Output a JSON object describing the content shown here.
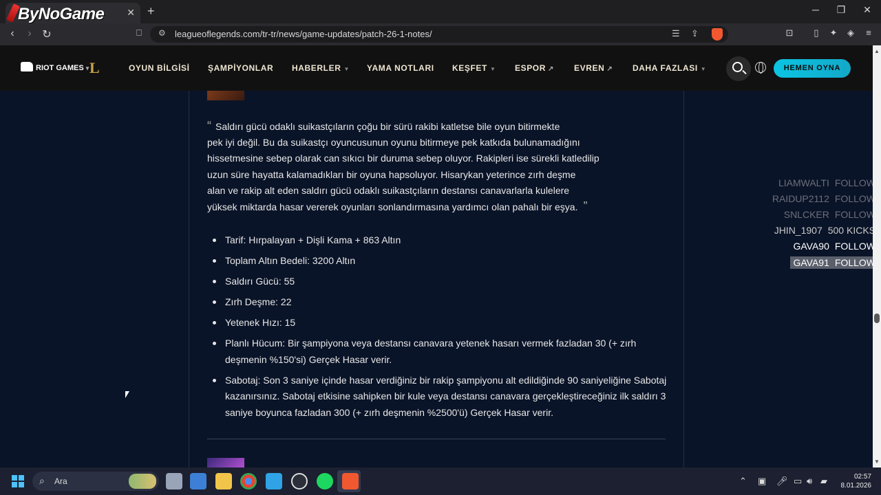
{
  "browser": {
    "tab_title": "ByNoGame",
    "url": "leagueoflegends.com/tr-tr/news/game-updates/patch-26-1-notes/"
  },
  "header": {
    "riot_logo": "RIOT GAMES",
    "nav": [
      {
        "label": "OYUN BİLGİSİ",
        "caret": false,
        "ext": false
      },
      {
        "label": "ŞAMPİYONLAR",
        "caret": false,
        "ext": false
      },
      {
        "label": "HABERLER",
        "caret": true,
        "ext": false
      },
      {
        "label": "YAMA NOTLARI",
        "caret": false,
        "ext": false
      },
      {
        "label": "KEŞFET",
        "caret": true,
        "ext": false
      },
      {
        "label": "ESPOR",
        "caret": false,
        "ext": true
      },
      {
        "label": "EVREN",
        "caret": false,
        "ext": true
      },
      {
        "label": "DAHA FAZLASI",
        "caret": true,
        "ext": false
      }
    ],
    "play_button": "HEMEN OYNA"
  },
  "article": {
    "quote": "Saldırı gücü odaklı suikastçıların çoğu bir sürü rakibi katletse bile oyun bitirmekte pek iyi değil. Bu da suikastçı oyuncusunun oyunu bitirmeye pek katkıda bulunamadığını hissetmesine sebep olarak can sıkıcı bir duruma sebep oluyor. Rakipleri ise sürekli katledilip uzun süre hayatta kalamadıkları bir oyuna hapsoluyor. Hisarykan yeterince zırh deşme alan ve rakip alt eden saldırı gücü odaklı suikastçıların destansı canavarlarla kulelere yüksek miktarda hasar vererek oyunları sonlandırmasına yardımcı olan pahalı bir eşya.",
    "quote_lines": [
      "Saldırı gücü odaklı suikastçıların çoğu bir sürü rakibi katletse bile oyun bitirmekte",
      "pek iyi değil. Bu da suikastçı oyuncusunun oyunu bitirmeye pek katkıda bulunamadığını",
      "hissetmesine sebep olarak can sıkıcı bir duruma sebep oluyor. Rakipleri ise sürekli katledilip",
      "uzun süre hayatta kalamadıkları bir oyuna hapsoluyor. Hisarykan yeterince zırh deşme",
      "alan ve rakip alt eden saldırı gücü odaklı suikastçıların destansı canavarlarla kulelere",
      "yüksek miktarda hasar vererek oyunları sonlandırmasına yardımcı olan pahalı bir eşya."
    ],
    "bullets": [
      "Tarif: Hırpalayan + Dişli Kama + 863 Altın",
      "Toplam Altın Bedeli: 3200 Altın",
      "Saldırı Gücü: 55",
      "Zırh Deşme: 22",
      "Yetenek Hızı: 15",
      "Planlı Hücum: Bir şampiyona veya destansı canavara yetenek hasarı vermek fazladan 30 (+ zırh deşmenin %150'si) Gerçek Hasar verir.",
      "Sabotaj: Son 3 saniye içinde hasar verdiğiniz bir rakip şampiyonu alt edildiğinde 90 saniyeliğine Sabotaj kazanırsınız. Sabotaj etkisine sahipken bir kule veya destansı canavara gerçekleştireceğiniz ilk saldırı 3 saniye boyunca fazladan 300 (+ zırh deşmenin %2500'ü) Gerçek Hasar verir."
    ]
  },
  "overlay": [
    {
      "user": "LIAMWALTI",
      "action": "FOLLOW",
      "color": "#6b6f7a"
    },
    {
      "user": "RAIDUP2112",
      "action": "FOLLOW",
      "color": "#6b6f7a"
    },
    {
      "user": "SNLCKER",
      "action": "FOLLOW",
      "color": "#6b6f7a"
    },
    {
      "user": "JHIN_1907",
      "action": "500 KICKS",
      "color": "#c9c9c9"
    },
    {
      "user": "GAVA90",
      "action": "FOLLOW",
      "color": "#ffffff"
    },
    {
      "user": "GAVA91",
      "action": "FOLLOW",
      "color": "#ffffff",
      "highlight": true
    }
  ],
  "taskbar": {
    "search_placeholder": "Ara",
    "time": "02:57",
    "date": "8.01.2026"
  }
}
